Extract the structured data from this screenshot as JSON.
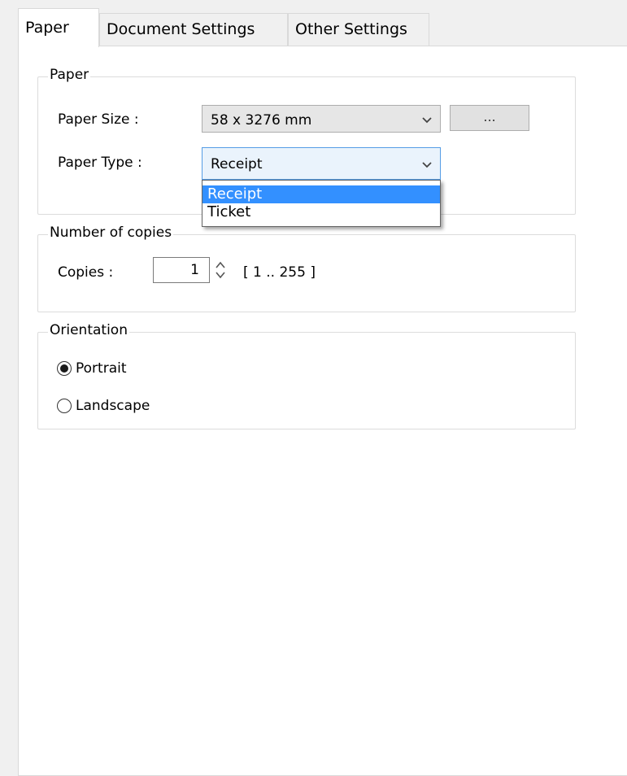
{
  "tabs": [
    {
      "label": "Paper",
      "active": true
    },
    {
      "label": "Document Settings",
      "active": false
    },
    {
      "label": "Other Settings",
      "active": false
    }
  ],
  "paper_group": {
    "legend": "Paper",
    "paper_size_label": "Paper Size :",
    "paper_size_value": "58 x 3276 mm",
    "browse_button_label": "...",
    "paper_type_label": "Paper Type :",
    "paper_type_value": "Receipt",
    "paper_type_options": [
      "Receipt",
      "Ticket"
    ],
    "paper_type_selected_option": "Receipt"
  },
  "copies_group": {
    "legend": "Number of copies",
    "copies_label": "Copies :",
    "copies_value": "1",
    "copies_range": "[ 1 .. 255 ]"
  },
  "orientation_group": {
    "legend": "Orientation",
    "options": [
      {
        "label": "Portrait",
        "checked": true
      },
      {
        "label": "Landscape",
        "checked": false
      }
    ]
  },
  "colors": {
    "selection_highlight": "#3390ff",
    "focus_border": "#569de5"
  },
  "icons": {
    "combo_arrow": "chevron-down-icon",
    "spinner": "spinner-arrows-icon",
    "radio": "radio-button"
  }
}
